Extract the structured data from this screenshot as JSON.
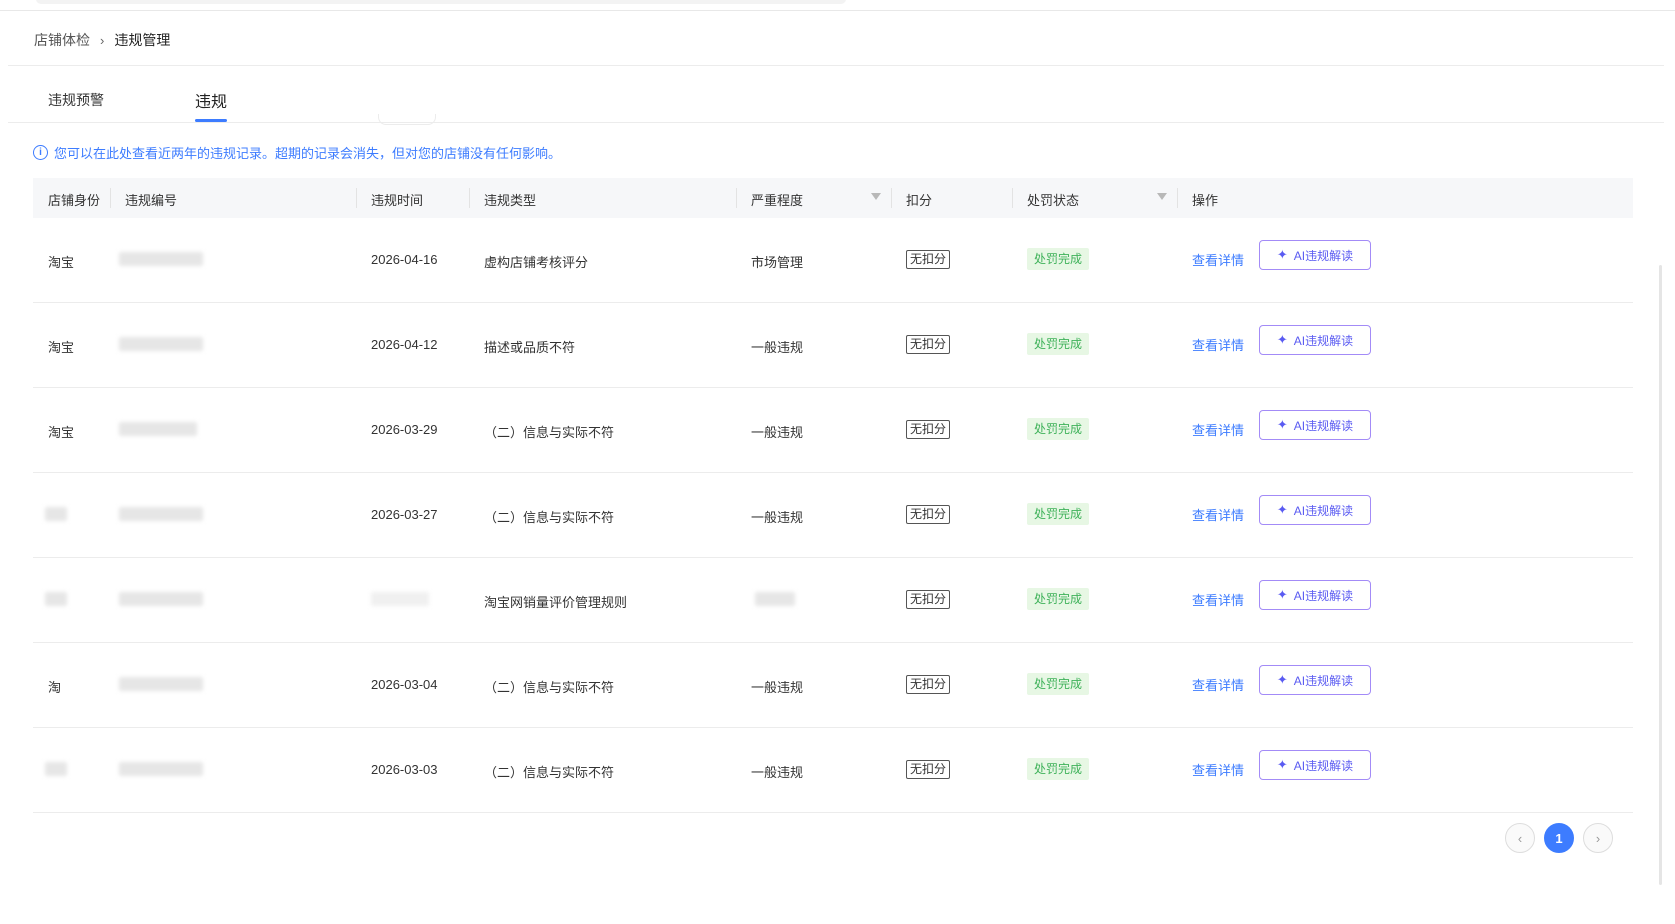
{
  "breadcrumb": {
    "parent": "店铺体检",
    "separator": "›",
    "current": "违规管理"
  },
  "tabs": [
    {
      "label": "违规预警"
    },
    {
      "label": "违规"
    }
  ],
  "notice": {
    "icon": "info-icon",
    "text": "您可以在此处查看近两年的违规记录。超期的记录会消失，但对您的店铺没有任何影响。"
  },
  "table": {
    "headers": [
      "店铺身份",
      "违规编号",
      "违规时间",
      "违规类型",
      "严重程度",
      "扣分",
      "处罚状态",
      "操作"
    ],
    "rows": [
      {
        "identity": "淘宝",
        "id": "",
        "date": "2026-04-16",
        "type": "虚构店铺考核评分",
        "severity": "市场管理",
        "deduction": "无扣分",
        "status": "处罚完成",
        "detail": "查看详情",
        "ai": "AI违规解读"
      },
      {
        "identity": "淘宝",
        "id": "",
        "date": "2026-04-12",
        "type": "描述或品质不符",
        "severity": "一般违规",
        "deduction": "无扣分",
        "status": "处罚完成",
        "detail": "查看详情",
        "ai": "AI违规解读"
      },
      {
        "identity": "淘宝",
        "id": "",
        "date": "2026-03-29",
        "type": "（二）信息与实际不符",
        "severity": "一般违规",
        "deduction": "无扣分",
        "status": "处罚完成",
        "detail": "查看详情",
        "ai": "AI违规解读"
      },
      {
        "identity": "",
        "id": "",
        "date": "2026-03-27",
        "type": "（二）信息与实际不符",
        "severity": "一般违规",
        "deduction": "无扣分",
        "status": "处罚完成",
        "detail": "查看详情",
        "ai": "AI违规解读"
      },
      {
        "identity": "",
        "id": "",
        "date": "",
        "type": "淘宝网销量评价管理规则",
        "severity": "",
        "deduction": "无扣分",
        "status": "处罚完成",
        "detail": "查看详情",
        "ai": "AI违规解读"
      },
      {
        "identity": "淘",
        "id": "",
        "date": "2026-03-04",
        "type": "（二）信息与实际不符",
        "severity": "一般违规",
        "deduction": "无扣分",
        "status": "处罚完成",
        "detail": "查看详情",
        "ai": "AI违规解读"
      },
      {
        "identity": "",
        "id": "",
        "date": "2026-03-03",
        "type": "（二）信息与实际不符",
        "severity": "一般违规",
        "deduction": "无扣分",
        "status": "处罚完成",
        "detail": "查看详情",
        "ai": "AI违规解读"
      }
    ]
  },
  "pagination": {
    "prev": "‹",
    "current": "1",
    "next": "›"
  },
  "colors": {
    "accent": "#3d7cff",
    "ai_border": "#a38bf7",
    "status_bg": "#e7f7e4",
    "status_text": "#3fb25a"
  }
}
